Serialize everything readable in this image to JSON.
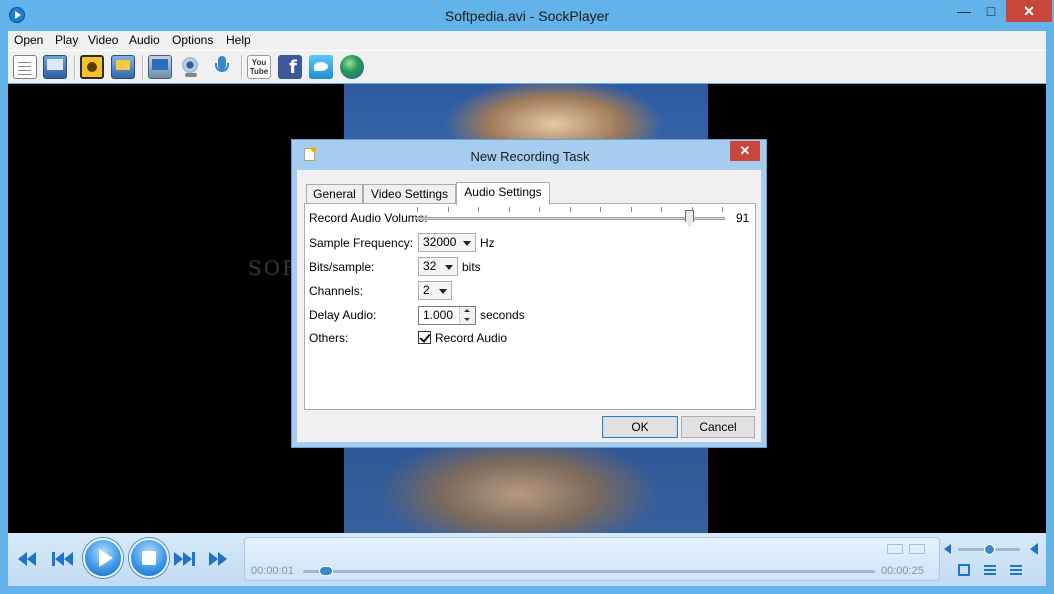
{
  "window": {
    "title": "Softpedia.avi - SockPlayer",
    "min_glyph": "—",
    "max_glyph": "□",
    "close_glyph": "✕"
  },
  "menu": {
    "items": [
      "Open",
      "Play",
      "Video",
      "Audio",
      "Options",
      "Help"
    ]
  },
  "toolbar": {
    "icons": [
      "new-file-icon",
      "open-folder-icon",
      "capture-icon",
      "screen-record-icon",
      "monitor-icon",
      "webcam-icon",
      "microphone-icon",
      "youtube-icon",
      "facebook-icon",
      "twitter-icon",
      "globe-icon"
    ],
    "youtube_text": "You Tube",
    "facebook_text": "f"
  },
  "video": {
    "watermark": "SOFTPEDIA"
  },
  "dialog": {
    "title": "New Recording Task",
    "close_glyph": "✕",
    "tabs": [
      {
        "label": "General",
        "active": false
      },
      {
        "label": "Video Settings",
        "active": false
      },
      {
        "label": "Audio Settings",
        "active": true
      }
    ],
    "fields": {
      "record_volume": {
        "label": "Record Audio Volume:",
        "value": "91",
        "level": 91,
        "max": 100
      },
      "sample_frequency": {
        "label": "Sample Frequency:",
        "value": "32000",
        "unit": "Hz"
      },
      "bits_sample": {
        "label": "Bits/sample:",
        "value": "32",
        "unit": "bits"
      },
      "channels": {
        "label": "Channels:",
        "value": "2"
      },
      "delay_audio": {
        "label": "Delay Audio:",
        "value": "1.000",
        "unit": "seconds"
      },
      "others": {
        "label": "Others:",
        "checkbox_label": "Record Audio",
        "checked": true
      }
    },
    "ok_label": "OK",
    "cancel_label": "Cancel"
  },
  "controls": {
    "time_current": "00:00:01",
    "time_total": "00:00:25",
    "seek_fraction": 0.04,
    "volume_fraction": 0.5
  },
  "colors": {
    "frame": "#62b3ea",
    "accent": "#1f74c8",
    "close_red": "#c7483b"
  }
}
